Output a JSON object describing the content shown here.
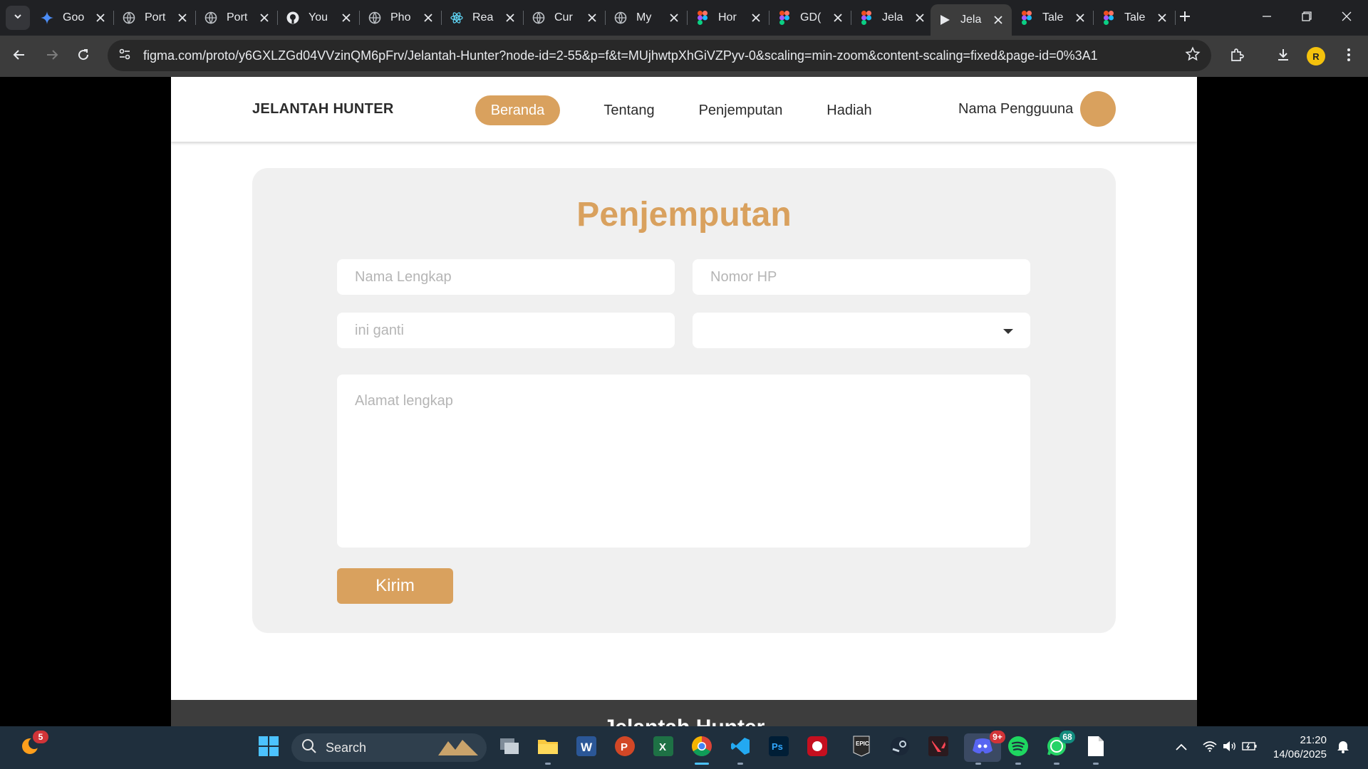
{
  "browser": {
    "tabs": [
      {
        "label": "Goo",
        "icon": "gemini-icon"
      },
      {
        "label": "Port",
        "icon": "globe-icon"
      },
      {
        "label": "Port",
        "icon": "globe-icon"
      },
      {
        "label": "You",
        "icon": "github-icon"
      },
      {
        "label": "Pho",
        "icon": "globe-icon"
      },
      {
        "label": "Rea",
        "icon": "react-icon"
      },
      {
        "label": "Cur",
        "icon": "globe-icon"
      },
      {
        "label": "My",
        "icon": "globe-icon"
      },
      {
        "label": "Hor",
        "icon": "figma-icon"
      },
      {
        "label": "GD(",
        "icon": "figma-icon"
      },
      {
        "label": "Jela",
        "icon": "figma-icon"
      },
      {
        "label": "Jela",
        "icon": "play-icon",
        "active": true
      },
      {
        "label": "Tale",
        "icon": "figma-icon"
      },
      {
        "label": "Tale",
        "icon": "figma-icon"
      }
    ],
    "url": "figma.com/proto/y6GXLZGd04VVzinQM6pFrv/Jelantah-Hunter?node-id=2-55&p=f&t=MUjhwtpXhGiVZPyv-0&scaling=min-zoom&content-scaling=fixed&page-id=0%3A1",
    "profile_initial": "R"
  },
  "site": {
    "logo": "JELANTAH HUNTER",
    "nav": [
      "Beranda",
      "Tentang",
      "Penjemputan",
      "Hadiah"
    ],
    "active_nav": "Beranda",
    "user_name": "Nama Pengguuna",
    "accent_color": "#d9a15e"
  },
  "form": {
    "title": "Penjemputan",
    "name_placeholder": "Nama Lengkap",
    "phone_placeholder": "Nomor HP",
    "ganti_placeholder": "ini ganti",
    "select_value": "",
    "address_placeholder": "Alamat lengkap",
    "submit_label": "Kirim"
  },
  "footer": {
    "title": "Jelantah Hunter"
  },
  "taskbar": {
    "search_label": "Search",
    "weather_badge": "5",
    "discord_badge": "9+",
    "whatsapp_badge": "68",
    "time": "21:20",
    "date": "14/06/2025"
  }
}
